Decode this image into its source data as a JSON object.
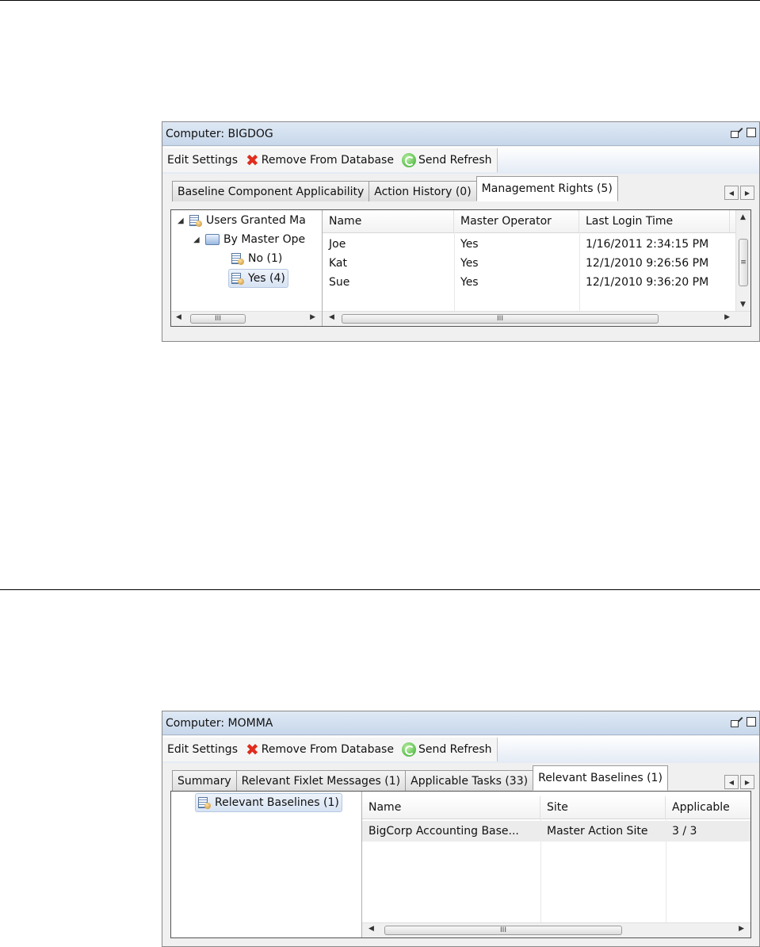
{
  "panel1": {
    "title": "Computer: BIGDOG",
    "toolbar": {
      "edit": "Edit Settings",
      "remove": "Remove From Database",
      "refresh": "Send Refresh"
    },
    "tabs": [
      "Baseline Component Applicability",
      "Action History (0)",
      "Management Rights (5)"
    ],
    "tree": {
      "root": "Users Granted Ma",
      "folder": "By Master Ope",
      "no": "No (1)",
      "yes": "Yes (4)"
    },
    "columns": [
      "Name",
      "Master Operator",
      "Last Login Time"
    ],
    "rows": [
      [
        "Joe",
        "Yes",
        "1/16/2011 2:34:15 PM"
      ],
      [
        "Kat",
        "Yes",
        "12/1/2010 9:26:56 PM"
      ],
      [
        "Sue",
        "Yes",
        "12/1/2010 9:36:20 PM"
      ]
    ],
    "scroll_glyph": "III",
    "vscroll_glyph": "≡"
  },
  "panel2": {
    "title": "Computer: MOMMA",
    "toolbar": {
      "edit": "Edit Settings",
      "remove": "Remove From Database",
      "refresh": "Send Refresh"
    },
    "tabs": [
      "Summary",
      "Relevant Fixlet Messages (1)",
      "Applicable Tasks (33)",
      "Relevant Baselines (1)"
    ],
    "tree": {
      "root": "Relevant Baselines (1)"
    },
    "columns": [
      "Name",
      "Site",
      "Applicable"
    ],
    "rows": [
      [
        "BigCorp Accounting Base...",
        "Master Action Site",
        "3 / 3"
      ]
    ],
    "scroll_glyph": "III"
  },
  "icons": [
    "undock-icon",
    "maximize-icon",
    "remove-x-icon",
    "refresh-icon",
    "scroll-left-icon",
    "scroll-right-icon",
    "tree-expand-icon",
    "user-list-icon",
    "folder-icon"
  ]
}
